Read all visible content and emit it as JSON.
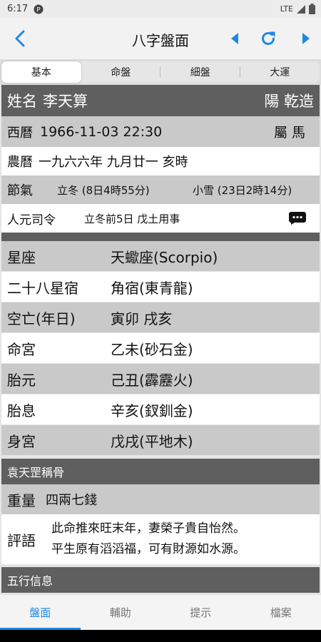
{
  "status": {
    "time": "6:17",
    "network": "LTE"
  },
  "appbar": {
    "title": "八字盤面"
  },
  "tabs": [
    {
      "label": "基本"
    },
    {
      "label": "命盤"
    },
    {
      "label": "細盤"
    },
    {
      "label": "大運"
    }
  ],
  "profile": {
    "name_label": "姓名",
    "name": "李天算",
    "gender": "陽 乾造",
    "solar_label": "西曆",
    "solar_datetime": "1966-11-03 22:30",
    "zodiac": "屬 馬",
    "lunar_label": "農曆",
    "lunar_date": "一九六六年 九月廿一 亥時",
    "jieqi_label": "節氣",
    "jieqi_prev": "立冬 (8日4時55分)",
    "jieqi_next": "小雪 (23日2時14分)",
    "renyuan_label": "人元司令",
    "renyuan_value": "立冬前5日 戊土用事"
  },
  "attributes": [
    {
      "key": "星座",
      "value": "天蠍座(Scorpio)"
    },
    {
      "key": "二十八星宿",
      "value": "角宿(東青龍)"
    },
    {
      "key": "空亡(年日)",
      "value": "寅卯 戌亥"
    },
    {
      "key": "命宮",
      "value": "乙未(砂石金)"
    },
    {
      "key": "胎元",
      "value": "己丑(霹靂火)"
    },
    {
      "key": "胎息",
      "value": "辛亥(釵釧金)"
    },
    {
      "key": "身宮",
      "value": "戊戌(平地木)"
    }
  ],
  "bone_weight": {
    "title": "袁天罡稱骨",
    "weight_label": "重量",
    "weight_value": "四兩七錢",
    "verdict_label": "評語",
    "verdict_line1": "此命推來旺末年，妻榮子貴自怡然。",
    "verdict_line2": "平生原有滔滔福，可有財源如水源。"
  },
  "five_elements": {
    "title": "五行信息"
  },
  "bottom_nav": [
    {
      "label": "盤面"
    },
    {
      "label": "輔助"
    },
    {
      "label": "提示"
    },
    {
      "label": "檔案"
    }
  ],
  "colors": {
    "accent": "#1e88e5",
    "dark_row": "#5f5f5f",
    "light_row": "#c9c9c9"
  },
  "icons": [
    "back-arrow-icon",
    "previous-triangle-icon",
    "refresh-icon",
    "next-triangle-icon",
    "comment-dots-icon"
  ]
}
